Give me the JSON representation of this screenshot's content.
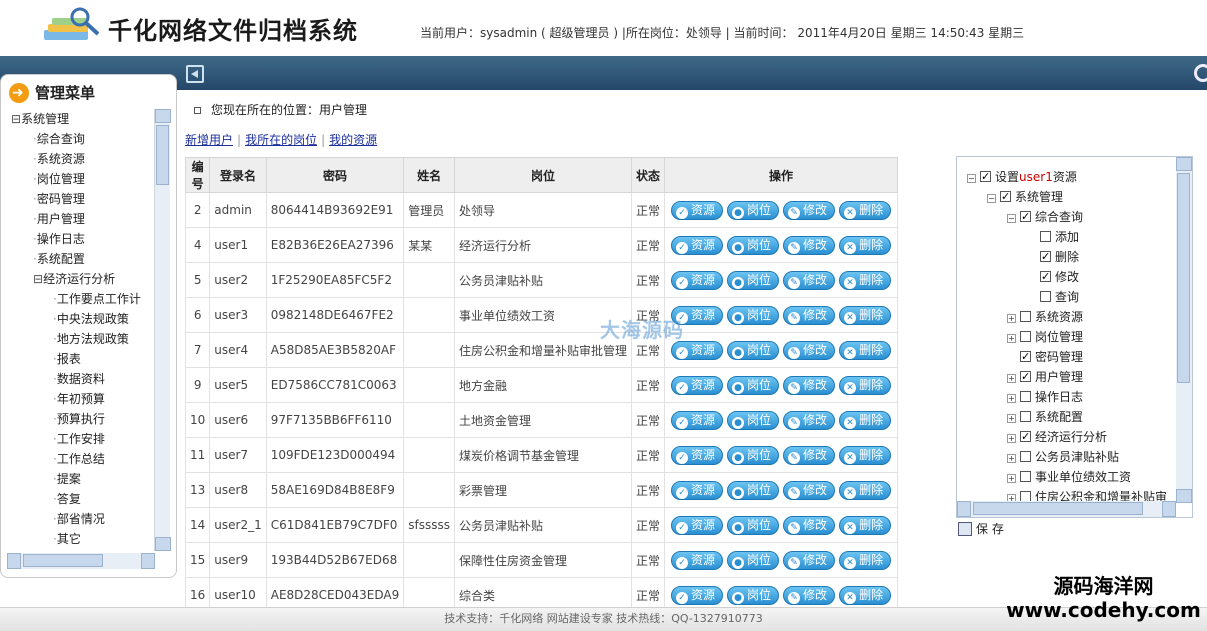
{
  "header": {
    "app_title": "千化网络文件归档系统",
    "user_info": "当前用户：sysadmin ( 超级管理员 ) |所在岗位：处领导 | 当前时间： 2011年4月20日 星期三 14:50:43 星期三"
  },
  "sidebar": {
    "title": "管理菜单",
    "items": [
      {
        "label": "系统管理",
        "prefix": "⊟"
      },
      {
        "label": "综合查询"
      },
      {
        "label": "系统资源"
      },
      {
        "label": "岗位管理"
      },
      {
        "label": "密码管理"
      },
      {
        "label": "用户管理"
      },
      {
        "label": "操作日志"
      },
      {
        "label": "系统配置"
      },
      {
        "label": "经济运行分析",
        "prefix": "⊟"
      },
      {
        "label": "工作要点工作计"
      },
      {
        "label": "中央法规政策"
      },
      {
        "label": "地方法规政策"
      },
      {
        "label": "报表"
      },
      {
        "label": "数据资料"
      },
      {
        "label": "年初预算"
      },
      {
        "label": "预算执行"
      },
      {
        "label": "工作安排"
      },
      {
        "label": "工作总结"
      },
      {
        "label": "提案"
      },
      {
        "label": "答复"
      },
      {
        "label": "部省情况"
      },
      {
        "label": "其它"
      }
    ]
  },
  "breadcrumb": "您现在所在的位置：用户管理",
  "links": {
    "new_user": "新增用户",
    "my_post": "我所在的岗位",
    "my_resource": "我的资源",
    "separator": "|"
  },
  "table": {
    "headers": [
      "编号",
      "登录名",
      "密码",
      "姓名",
      "岗位",
      "状态",
      "操作"
    ],
    "actions": {
      "resource": "资源",
      "post": "岗位",
      "edit": "修改",
      "delete": "删除"
    },
    "rows": [
      {
        "id": "2",
        "login": "admin",
        "password": "8064414B93692E91",
        "name": "管理员",
        "post": "处领导",
        "status": "正常"
      },
      {
        "id": "4",
        "login": "user1",
        "password": "E82B36E26EA27396",
        "name": "某某",
        "post": "经济运行分析",
        "status": "正常"
      },
      {
        "id": "5",
        "login": "user2",
        "password": "1F25290EA85FC5F2",
        "name": "",
        "post": "公务员津贴补贴",
        "status": "正常"
      },
      {
        "id": "6",
        "login": "user3",
        "password": "0982148DE6467FE2",
        "name": "",
        "post": "事业单位绩效工资",
        "status": "正常"
      },
      {
        "id": "7",
        "login": "user4",
        "password": "A58D85AE3B5820AF",
        "name": "",
        "post": "住房公积金和增量补贴审批管理",
        "status": "正常"
      },
      {
        "id": "9",
        "login": "user5",
        "password": "ED7586CC781C0063",
        "name": "",
        "post": "地方金融",
        "status": "正常"
      },
      {
        "id": "10",
        "login": "user6",
        "password": "97F7135BB6FF6110",
        "name": "",
        "post": "土地资金管理",
        "status": "正常"
      },
      {
        "id": "11",
        "login": "user7",
        "password": "109FDE123D000494",
        "name": "",
        "post": "煤炭价格调节基金管理",
        "status": "正常"
      },
      {
        "id": "13",
        "login": "user8",
        "password": "58AE169D84B8E8F9",
        "name": "",
        "post": "彩票管理",
        "status": "正常"
      },
      {
        "id": "14",
        "login": "user2_1",
        "password": "C61D841EB79C7DF0",
        "name": "sfsssss",
        "post": "公务员津贴补贴",
        "status": "正常"
      },
      {
        "id": "15",
        "login": "user9",
        "password": "193B44D52B67ED68",
        "name": "",
        "post": "保障性住房资金管理",
        "status": "正常"
      },
      {
        "id": "16",
        "login": "user10",
        "password": "AE8D28CED043EDA9",
        "name": "",
        "post": "综合类",
        "status": "正常"
      }
    ]
  },
  "watermark": "大海源码",
  "permissions": {
    "root": {
      "label_prefix": "设置",
      "label_user": "user1",
      "label_suffix": "资源"
    },
    "items": [
      {
        "label": "系统管理",
        "checked": true,
        "level": 1,
        "expand": "−"
      },
      {
        "label": "综合查询",
        "checked": true,
        "level": 2,
        "expand": "−"
      },
      {
        "label": "添加",
        "checked": false,
        "level": 3,
        "expand": ""
      },
      {
        "label": "删除",
        "checked": true,
        "level": 3,
        "expand": ""
      },
      {
        "label": "修改",
        "checked": true,
        "level": 3,
        "expand": ""
      },
      {
        "label": "查询",
        "checked": false,
        "level": 3,
        "expand": ""
      },
      {
        "label": "系统资源",
        "checked": false,
        "level": 2,
        "expand": "+"
      },
      {
        "label": "岗位管理",
        "checked": false,
        "level": 2,
        "expand": "+"
      },
      {
        "label": "密码管理",
        "checked": true,
        "level": 2,
        "expand": ""
      },
      {
        "label": "用户管理",
        "checked": true,
        "level": 2,
        "expand": "+"
      },
      {
        "label": "操作日志",
        "checked": false,
        "level": 2,
        "expand": "+"
      },
      {
        "label": "系统配置",
        "checked": false,
        "level": 2,
        "expand": "+"
      },
      {
        "label": "经济运行分析",
        "checked": true,
        "level": 2,
        "expand": "+"
      },
      {
        "label": "公务员津贴补贴",
        "checked": false,
        "level": 2,
        "expand": "+"
      },
      {
        "label": "事业单位绩效工资",
        "checked": false,
        "level": 2,
        "expand": "+"
      },
      {
        "label": "住房公积金和增量补贴审",
        "checked": false,
        "level": 2,
        "expand": "+"
      }
    ],
    "save_label": "保 存"
  },
  "footer": "技术支持：千化网络 网站建设专家 技术热线：QQ-1327910773",
  "brand": {
    "line1": "源码海洋网",
    "line2": "www.codehy.com"
  },
  "colors": {
    "topbar": "#2f5878",
    "button": "#2a8fd1",
    "link": "#1c2f9a",
    "user_highlight": "#cc0000"
  }
}
